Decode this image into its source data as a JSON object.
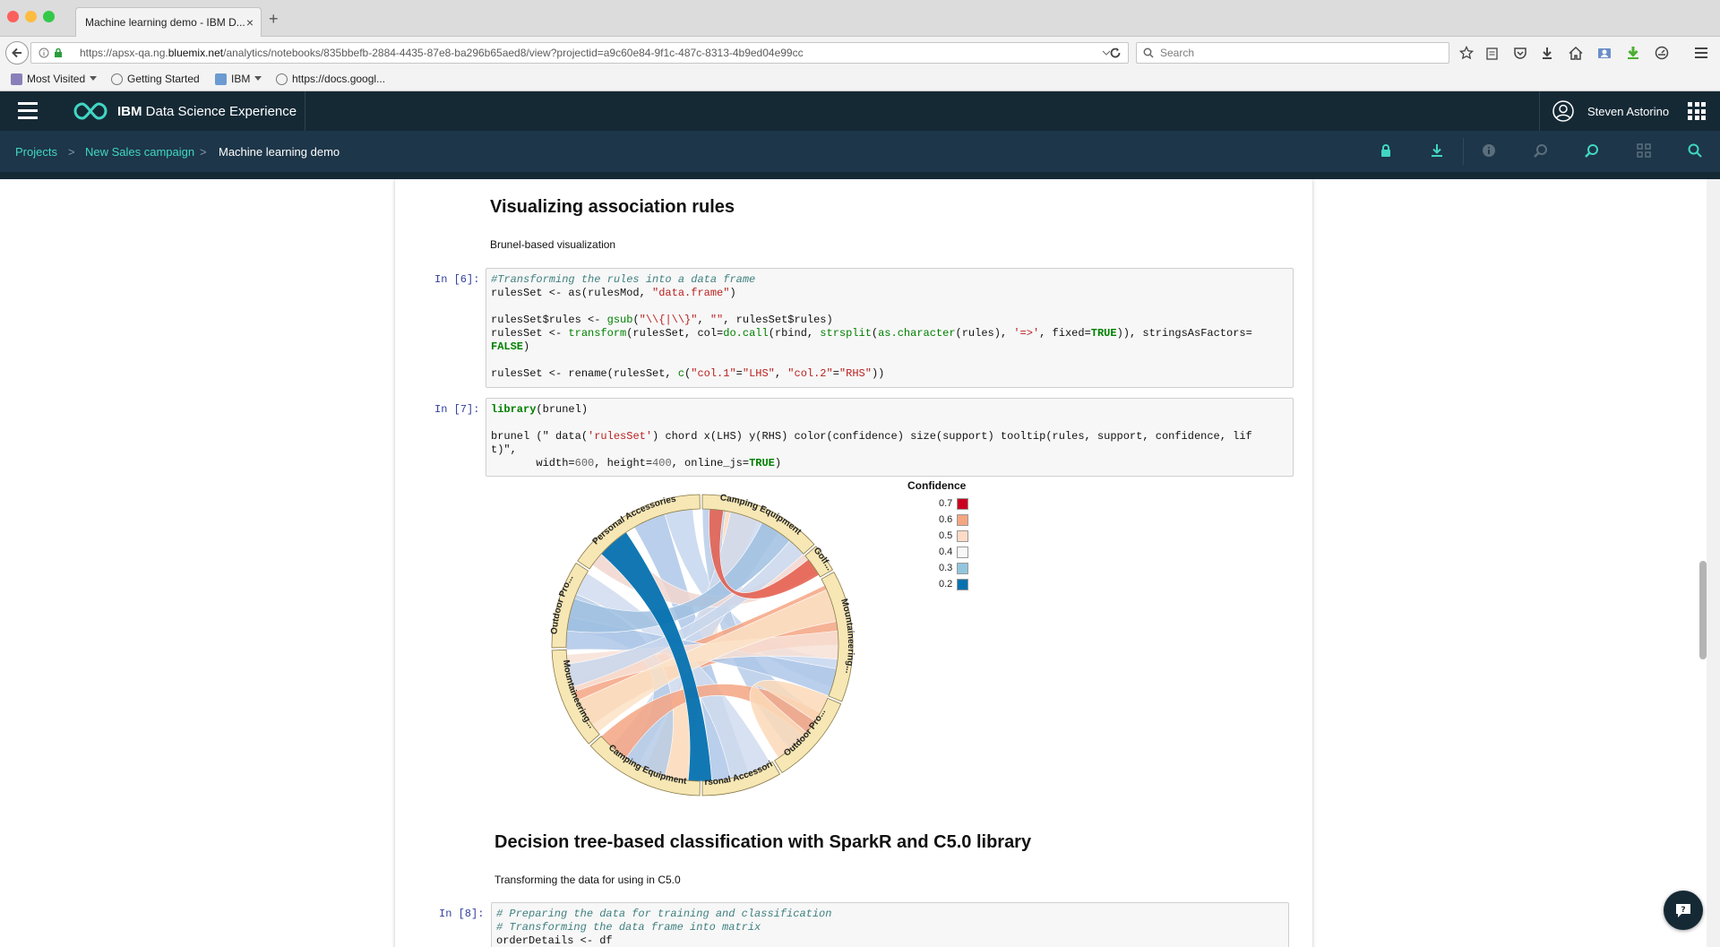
{
  "browser": {
    "tab_title": "Machine learning demo - IBM D...",
    "tab_close": "×",
    "new_tab": "+",
    "url_prefix": "https://apsx-qa.ng.",
    "url_domain": "bluemix.net",
    "url_rest": "/analytics/notebooks/835bbefb-2884-4435-87e8-ba296b65aed8/view?projectid=a9c60e84-9f1c-487c-8313-4b9ed04e99cc",
    "search_placeholder": "Search",
    "bookmarks": [
      {
        "label": "Most Visited",
        "icon": "folder-icon"
      },
      {
        "label": "Getting Started",
        "icon": "globe-icon"
      },
      {
        "label": "IBM",
        "icon": "folder-icon"
      },
      {
        "label": "https://docs.googl...",
        "icon": "globe-icon"
      }
    ]
  },
  "app": {
    "title": "IBM Data Science Experience",
    "title_bold": "IBM",
    "title_rest": " Data Science Experience",
    "user_name": "Steven Astorino",
    "brand_color": "#152935",
    "accent_color": "#41d6c3"
  },
  "breadcrumb": {
    "items": [
      "Projects",
      "New Sales campaign",
      "Machine learning demo"
    ],
    "separator": ">"
  },
  "notebook": {
    "heading1": "Visualizing association rules",
    "para1": "Brunel-based visualization",
    "cell6": {
      "prompt": "In [6]:",
      "lines": [
        "#Transforming the rules into a data frame",
        "rulesSet <- as(rulesMod, \"data.frame\")",
        "",
        "rulesSet$rules <- gsub(\"\\\\{|\\\\}\", \"\", rulesSet$rules)",
        "rulesSet <- transform(rulesSet, col=do.call(rbind, strsplit(as.character(rules), '=>', fixed=TRUE)), stringsAsFactors=",
        "FALSE)",
        "",
        "rulesSet <- rename(rulesSet, c(\"col.1\"=\"LHS\", \"col.2\"=\"RHS\"))"
      ]
    },
    "cell7": {
      "prompt": "In [7]:",
      "lines": [
        "library(brunel)",
        "",
        "brunel (\" data('rulesSet') chord x(LHS) y(RHS) color(confidence) size(support) tooltip(rules, support, confidence, lif",
        "t)\",",
        "       width=600, height=400, online_js=TRUE)"
      ]
    },
    "heading2": "Decision tree-based classification with SparkR and C5.0 library",
    "para2": "Transforming the data for using in C5.0",
    "cell8": {
      "prompt": "In [8]:",
      "lines": [
        "# Preparing the data for training and classification",
        "# Transforming the data frame into matrix",
        "orderDetails <- df"
      ]
    }
  },
  "chart_data": {
    "type": "chord",
    "segment_labels": [
      "Camping Equipment",
      "Golf...",
      "Mountaineering...",
      "Outdoor Pro...",
      "Personal Accessories",
      "Camping Equipment",
      "Mountaineering...",
      "Outdoor Pro...",
      "Personal Accessories"
    ],
    "legend": {
      "title": "Confidence",
      "entries": [
        {
          "label": "0.7",
          "color": "#ca0020"
        },
        {
          "label": "0.6",
          "color": "#f4a582"
        },
        {
          "label": "0.5",
          "color": "#fddbc7"
        },
        {
          "label": "0.4",
          "color": "#f7f7f7"
        },
        {
          "label": "0.3",
          "color": "#92c5de"
        },
        {
          "label": "0.2",
          "color": "#0571b0"
        }
      ]
    },
    "legend_placement": "right"
  }
}
